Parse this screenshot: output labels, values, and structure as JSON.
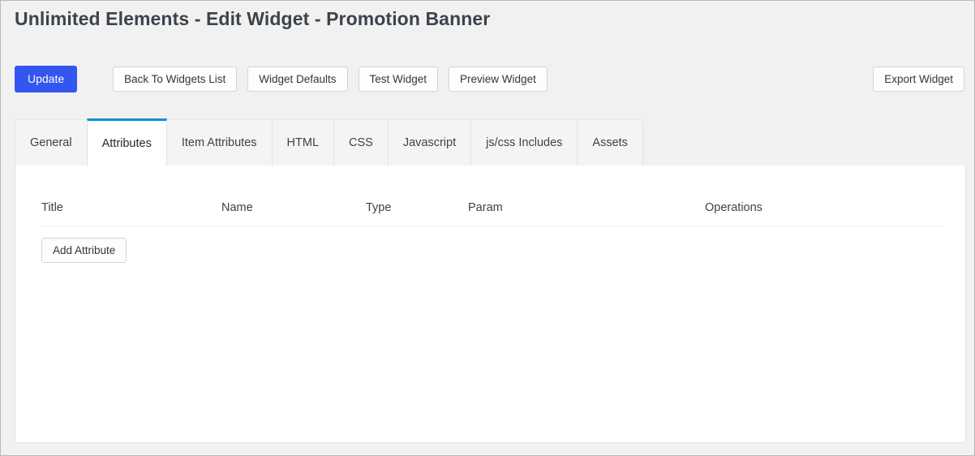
{
  "page": {
    "title": "Unlimited Elements - Edit Widget - Promotion Banner"
  },
  "toolbar": {
    "update_label": "Update",
    "back_to_widgets_list_label": "Back To Widgets List",
    "widget_defaults_label": "Widget Defaults",
    "test_widget_label": "Test Widget",
    "preview_widget_label": "Preview Widget",
    "export_widget_label": "Export Widget"
  },
  "tabs": [
    {
      "label": "General",
      "active": false
    },
    {
      "label": "Attributes",
      "active": true
    },
    {
      "label": "Item Attributes",
      "active": false
    },
    {
      "label": "HTML",
      "active": false
    },
    {
      "label": "CSS",
      "active": false
    },
    {
      "label": "Javascript",
      "active": false
    },
    {
      "label": "js/css Includes",
      "active": false
    },
    {
      "label": "Assets",
      "active": false
    }
  ],
  "attributes_panel": {
    "columns": [
      "Title",
      "Name",
      "Type",
      "Param",
      "Operations"
    ],
    "rows": [],
    "add_attribute_label": "Add Attribute"
  },
  "colors": {
    "primary_blue": "#3355f0",
    "active_tab_border": "#0d8fe0",
    "page_background": "#f1f1f1",
    "panel_background": "#ffffff",
    "text": "#3c434a",
    "border": "#e2e2e2"
  }
}
